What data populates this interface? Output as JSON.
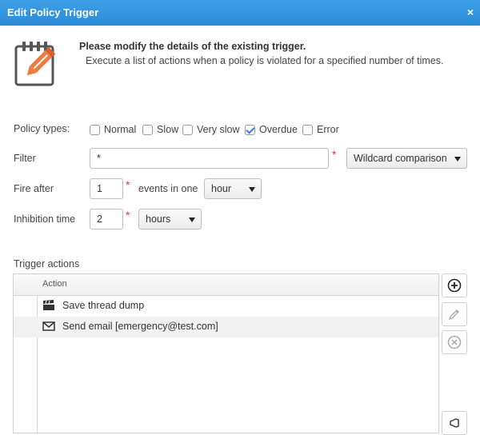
{
  "dialog": {
    "title": "Edit Policy Trigger",
    "close_glyph": "×"
  },
  "header": {
    "icon": "edit-note-icon",
    "title": "Please modify the details of the existing trigger.",
    "subtitle": "Execute a list of actions when a policy is violated for a specified number of times."
  },
  "form": {
    "policy_types_label": "Policy types:",
    "policy_types": [
      {
        "label": "Normal",
        "checked": false
      },
      {
        "label": "Slow",
        "checked": false
      },
      {
        "label": "Very slow",
        "checked": false
      },
      {
        "label": "Overdue",
        "checked": true
      },
      {
        "label": "Error",
        "checked": false
      }
    ],
    "filter_label": "Filter",
    "filter_value": "*",
    "filter_mode": "Wildcard comparison",
    "fire_after_label": "Fire after",
    "fire_after_value": "1",
    "events_text": "events in one",
    "fire_unit": "hour",
    "inhibition_label": "Inhibition time",
    "inhibition_value": "2",
    "inhibition_unit": "hours",
    "required_mark": "*"
  },
  "actions": {
    "section_label": "Trigger actions",
    "column_header": "Action",
    "rows": [
      {
        "icon": "clapperboard-icon",
        "label": "Save thread dump"
      },
      {
        "icon": "envelope-icon",
        "label": "Send email [emergency@test.com]"
      }
    ],
    "buttons": [
      "add-icon",
      "edit-icon",
      "remove-icon",
      "test-icon"
    ]
  },
  "colors": {
    "titlebar": "#2a8ad8",
    "accent_icon": "#f07b3f",
    "required": "#e03a2f"
  }
}
